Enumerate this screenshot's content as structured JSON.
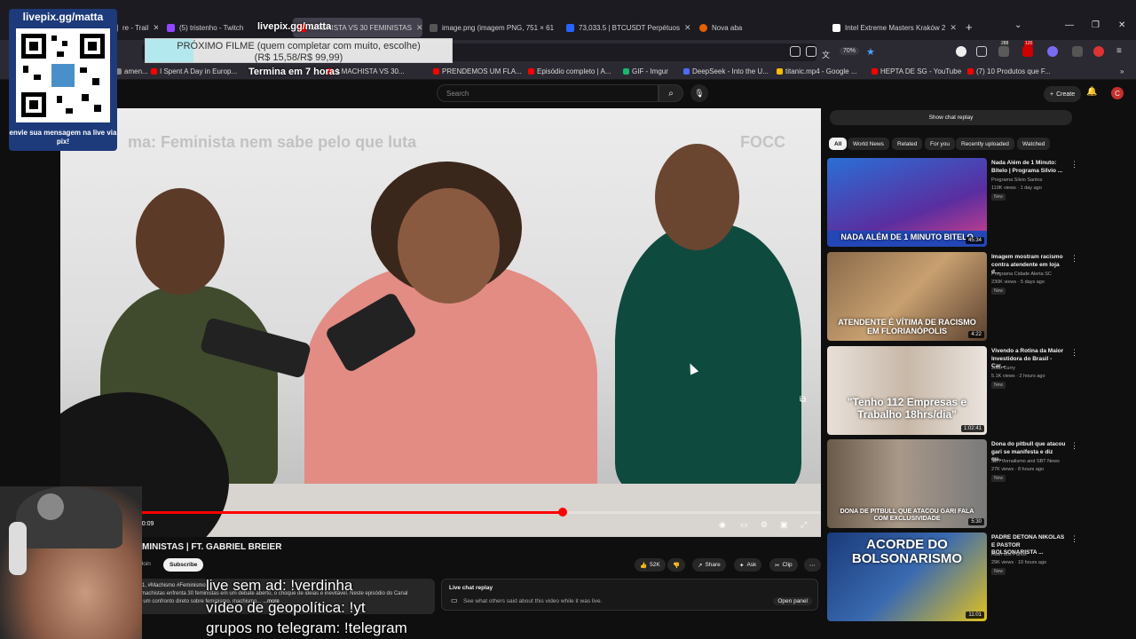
{
  "tabs": [
    {
      "label": "re - Trail",
      "color": "#8a8a8a"
    },
    {
      "label": "(5) tristenho - Twitch",
      "color": "#9146ff"
    },
    {
      "label": "MACHISTA VS 30 FEMINISTAS",
      "color": "#ff0000"
    },
    {
      "label": "image.png (imagem PNG, 751 × 61",
      "color": "#555555"
    },
    {
      "label": "73,033.5 | BTCUSDT Perpétuos",
      "color": "#2962ff"
    },
    {
      "label": "Nova aba",
      "color": "#e66000"
    },
    {
      "label": "Intel Extreme Masters Kraków 2",
      "color": "#ffffff"
    }
  ],
  "browser": {
    "zoom": "70%",
    "badges": [
      "288",
      "120"
    ]
  },
  "bookmarks": [
    {
      "label": "amen...",
      "color": "#888888"
    },
    {
      "label": "I Spent A Day in Europ...",
      "color": "#ff0000"
    },
    {
      "label": "1 MACHISTA VS 30...",
      "color": "#ff0000"
    },
    {
      "label": "PRENDEMOS UM FLA...",
      "color": "#ff0000"
    },
    {
      "label": "Episódio completo | A...",
      "color": "#ff0000"
    },
    {
      "label": "GIF - Imgur",
      "color": "#1bb76e"
    },
    {
      "label": "DeepSeek - Into the U...",
      "color": "#4d6bfe"
    },
    {
      "label": "titanic.mp4 - Google ...",
      "color": "#fbbc04"
    },
    {
      "label": "HEPTA DE SG - YouTube",
      "color": "#ff0000"
    },
    {
      "label": "(7) 10 Produtos que F...",
      "color": "#ff0000"
    }
  ],
  "youtube": {
    "search_placeholder": "Search",
    "create_label": "Create",
    "avatar_letter": "C"
  },
  "video": {
    "overlay_title": "ma: Feminista nem sabe pelo que luta",
    "overlay_logo": "FOCC",
    "timecode": "1:20:09",
    "progress": 0.66,
    "title": "MINISTAS | FT. GABRIEL BREIER",
    "join_label": "Join",
    "subscribe_label": "Subscribe",
    "likes": "52K",
    "share_label": "Share",
    "ask_label": "Ask",
    "clip_label": "Clip",
    "description_line1": "Feb 1,  #Machismo #Feminismo",
    "description_line2": "ses machistas enfrenta 30 feministas em um debate aberto, o choque de ideias é inevitável. Neste episódio do Canal",
    "description_line3": "e de um confronto direto sobre feminismo, machismo...",
    "description_more": "...more"
  },
  "live_chat": {
    "title": "Live chat replay",
    "subtitle": "See what others said about this video while it was live.",
    "open_label": "Open panel",
    "show_label": "Show chat replay"
  },
  "chips": [
    "All",
    "World News",
    "Related",
    "For you",
    "Recently uploaded",
    "Watched"
  ],
  "recommendations": [
    {
      "title": "Nada Além de 1 Minuto: Bitelo | Programa Silvio ...",
      "channel": "Programa Silvio Santos",
      "views": "119K views · 1 day ago",
      "badge": "New",
      "duration": "45:34",
      "caption": "NADA ALÉM DE 1 MINUTO BITELO",
      "bg": "#3a2f9e"
    },
    {
      "title": "Imagem mostram racismo contra atendente em loja d...",
      "channel": "Programa Cidade Alerta SC",
      "views": "230K views · 5 days ago",
      "badge": "New",
      "duration": "4:22",
      "caption": "ATENDENTE É VÍTIMA DE RACISMO EM FLORIANÓPOLIS",
      "bg": "#7a5a3a"
    },
    {
      "title": "Vivendo a Rotina da Maior Investidora do Brasil - Car...",
      "channel": "Joao Curry",
      "views": "5.1K views · 2 hours ago",
      "badge": "New",
      "duration": "1:02:41",
      "caption": "\"Tenho 112 Empresas e Trabalho 18hrs/dia\"",
      "bg": "#d8d0c8"
    },
    {
      "title": "Dona do pitbull que atacou gari se manifesta e diz qu...",
      "channel": "SBT Jornalismo and SBT News",
      "views": "27K views · 8 hours ago",
      "badge": "New",
      "duration": "5:30",
      "caption": "DONA DE PITBULL QUE ATACOU GARI FALA COM EXCLUSIVIDADE",
      "bg": "#5a5048"
    },
    {
      "title": "PADRE DETONA NIKOLAS E PASTOR BOLSONARISTA ...",
      "channel": "Allan dos Panos",
      "views": "29K views · 10 hours ago",
      "badge": "New",
      "duration": "11:01",
      "caption": "ACORDE DO BOLSONARISMO",
      "bg": "#2a4a7a"
    }
  ],
  "stream": {
    "qr_header": "livepix.gg/matta",
    "qr_footer": "envie sua mensagem na live via pix!",
    "pix_title": "livepix.gg/matta",
    "goal_line1": "PRÓXIMO FILME (quem completar com muito, escolhe)",
    "goal_line2": "(R$ 15,58/R$ 99,99)",
    "goal_progress": 0.156,
    "goal_ends": "Termina em 7 horas",
    "commands": [
      "live sem ad: !verdinha",
      "vídeo de geopolítica: !yt",
      "grupos no telegram: !telegram"
    ]
  }
}
